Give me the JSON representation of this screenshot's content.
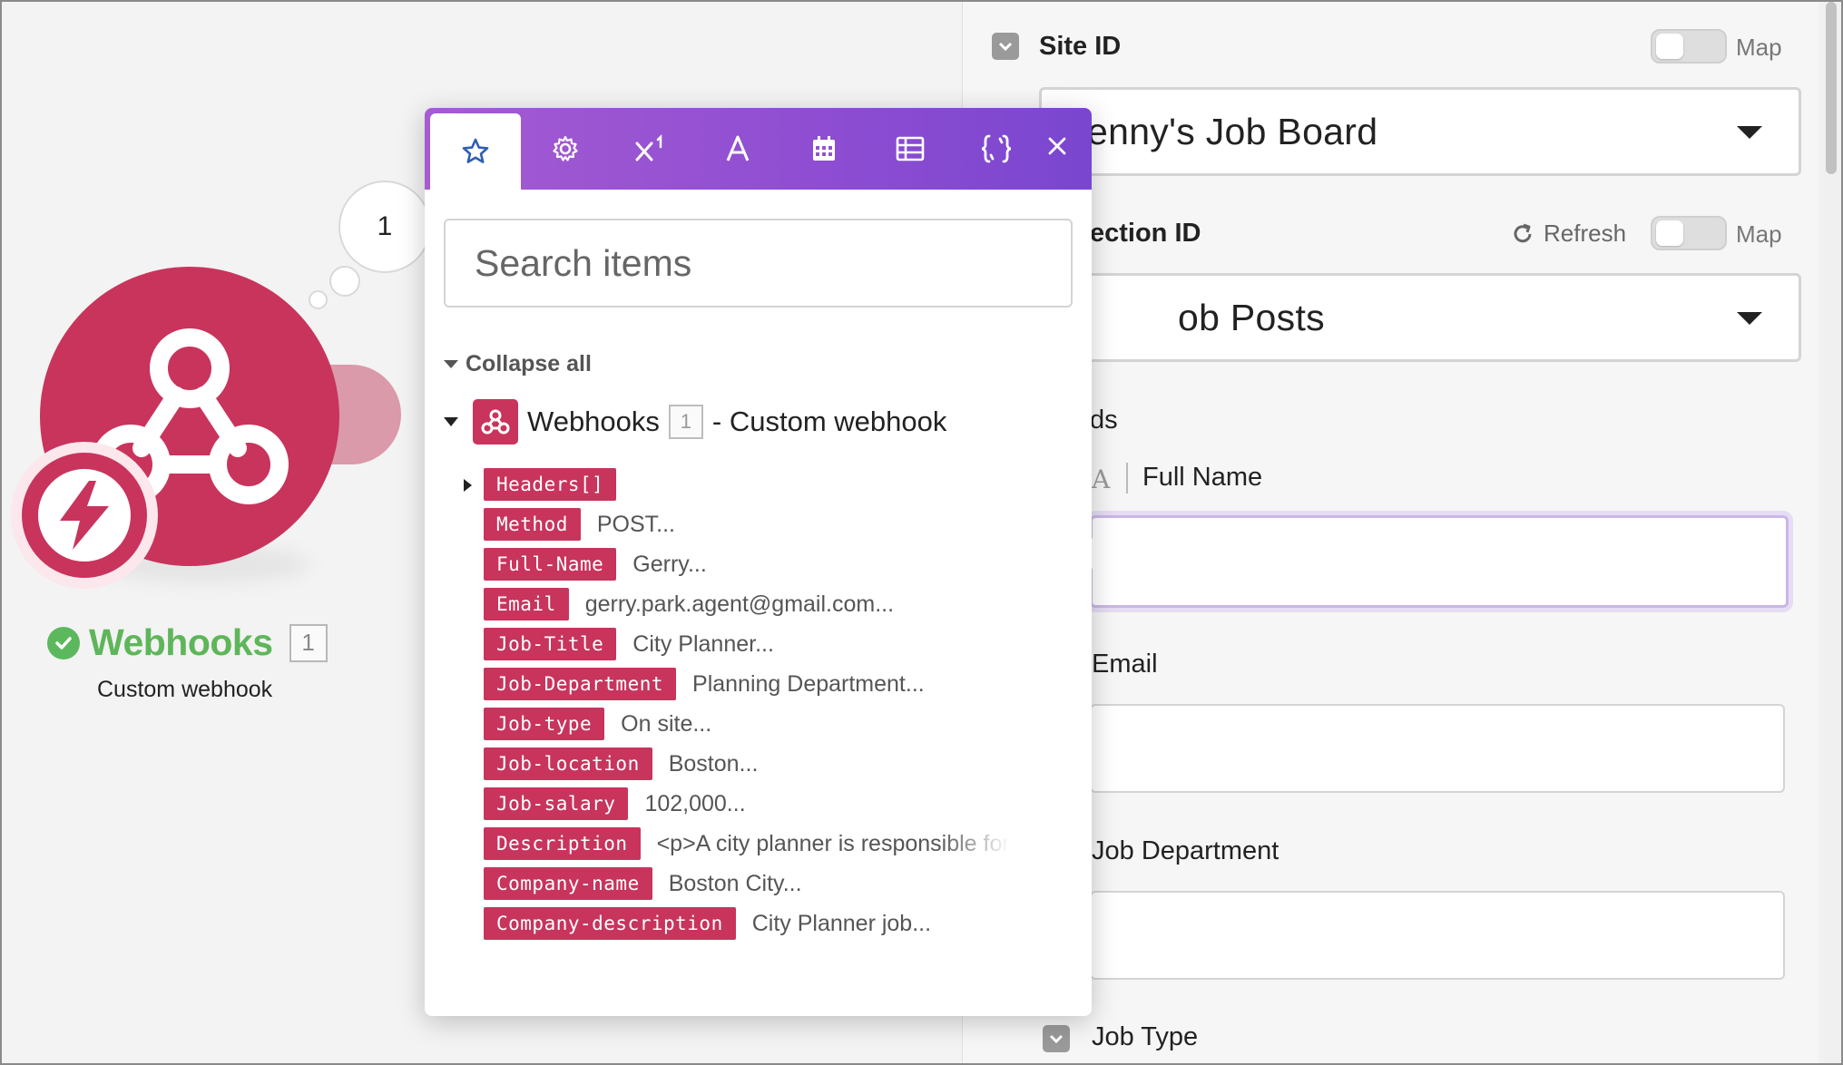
{
  "canvas": {
    "operation_count": "1",
    "module": {
      "title": "Webhooks",
      "count": "1",
      "subtitle": "Custom webhook"
    }
  },
  "form": {
    "site_id": {
      "label": "Site ID",
      "map_label": "Map",
      "value": "enny's Job Board"
    },
    "collection_id": {
      "label": "ection ID",
      "refresh_label": "Refresh",
      "map_label": "Map",
      "value": "ob Posts"
    },
    "fields_label": "ds",
    "full_name": {
      "type_badge": "A",
      "label": "Full Name"
    },
    "email": {
      "label": "Email"
    },
    "job_department": {
      "label": "Job Department"
    },
    "job_type": {
      "label": "Job Type"
    }
  },
  "popup": {
    "tabs": [
      {
        "name": "favorites",
        "icon": "star-icon"
      },
      {
        "name": "general",
        "icon": "gear-icon"
      },
      {
        "name": "math",
        "icon": "superscript-icon"
      },
      {
        "name": "text",
        "icon": "text-icon"
      },
      {
        "name": "date",
        "icon": "calendar-icon"
      },
      {
        "name": "array",
        "icon": "table-icon"
      },
      {
        "name": "custom",
        "icon": "braces-icon"
      }
    ],
    "search_placeholder": "Search items",
    "collapse_all": "Collapse all",
    "module": {
      "name": "Webhooks",
      "count": "1",
      "description": "- Custom webhook"
    },
    "items": [
      {
        "key": "Headers[]",
        "value": "",
        "expandable": true
      },
      {
        "key": "Method",
        "value": "POST..."
      },
      {
        "key": "Full-Name",
        "value": "Gerry..."
      },
      {
        "key": "Email",
        "value": "gerry.park.agent@gmail.com..."
      },
      {
        "key": "Job-Title",
        "value": "City Planner..."
      },
      {
        "key": "Job-Department",
        "value": "Planning Department..."
      },
      {
        "key": "Job-type",
        "value": "On site..."
      },
      {
        "key": "Job-location",
        "value": "Boston..."
      },
      {
        "key": "Job-salary",
        "value": "102,000..."
      },
      {
        "key": "Description",
        "value": "<p>A city planner is responsible for"
      },
      {
        "key": "Company-name",
        "value": "Boston City..."
      },
      {
        "key": "Company-description",
        "value": "City Planner job..."
      }
    ]
  },
  "colors": {
    "webhook_brand": "#c8345c",
    "success": "#5cb85c",
    "popup_tab_bar": "#9a55d2",
    "focus_ring": "#c9b7e6"
  }
}
